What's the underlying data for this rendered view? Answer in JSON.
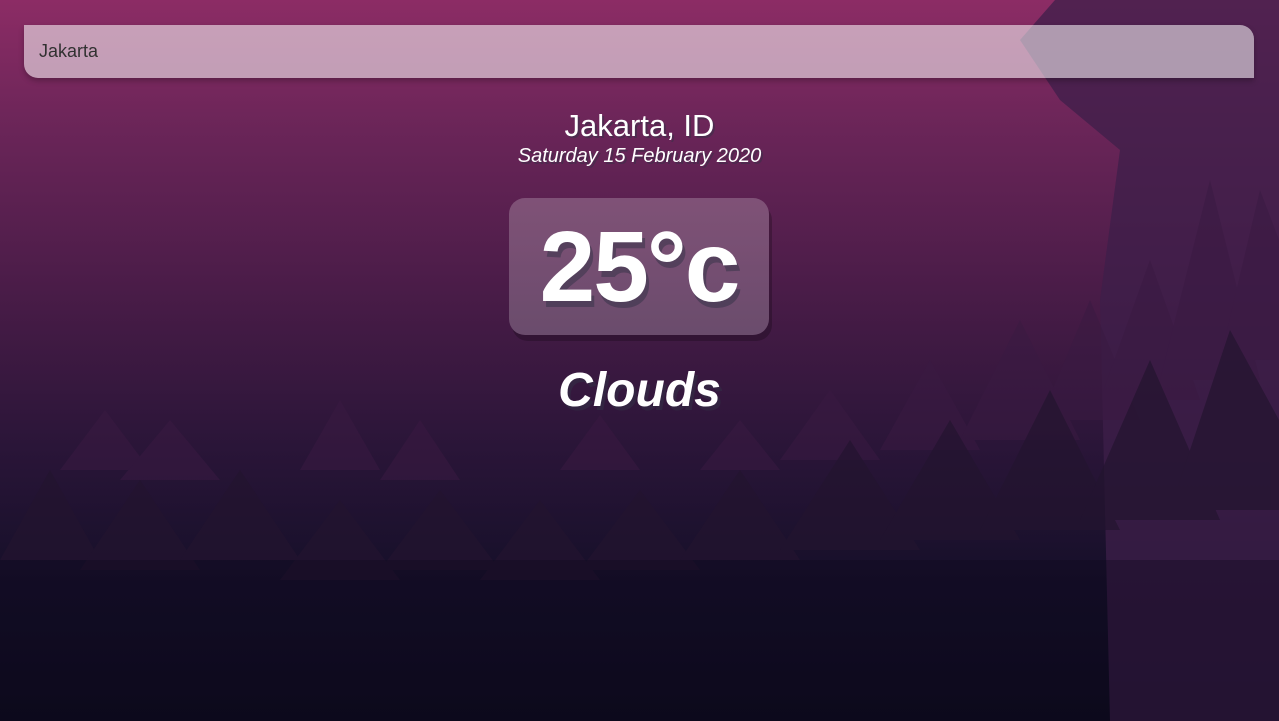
{
  "search": {
    "value": "Jakarta",
    "placeholder": ""
  },
  "location": {
    "city_country": "Jakarta, ID",
    "date": "Saturday 15 February 2020"
  },
  "weather": {
    "temperature": "25°c",
    "condition": "Clouds"
  }
}
